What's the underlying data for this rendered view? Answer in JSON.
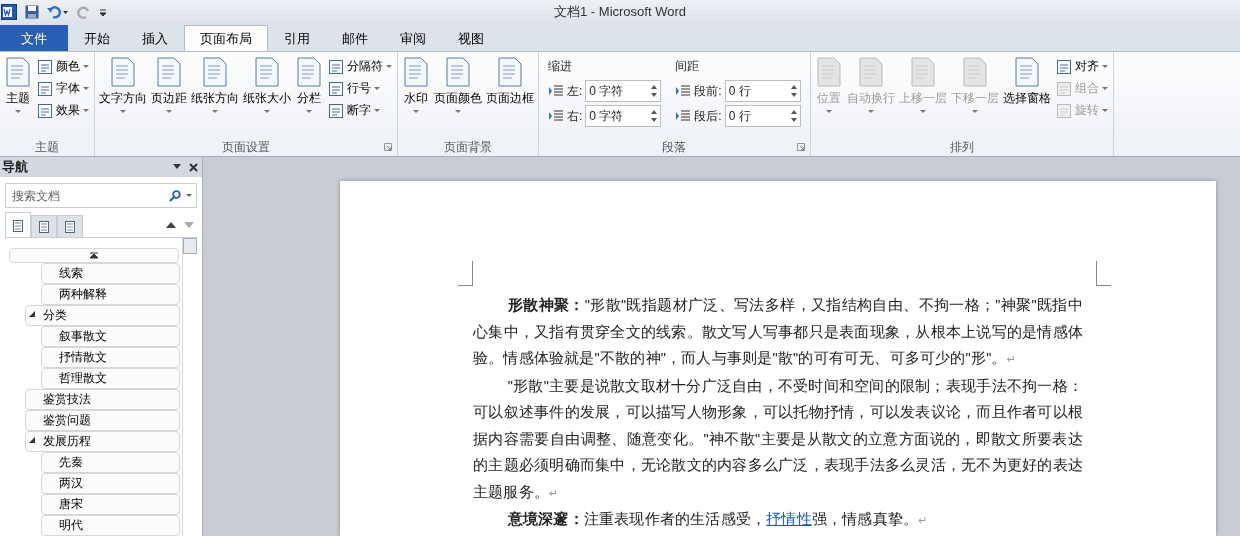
{
  "window": {
    "title": "文档1  -  Microsoft Word"
  },
  "tabs": [
    {
      "label": "文件",
      "kind": "file",
      "selected": false
    },
    {
      "label": "开始",
      "kind": "tab",
      "selected": false
    },
    {
      "label": "插入",
      "kind": "tab",
      "selected": false
    },
    {
      "label": "页面布局",
      "kind": "tab",
      "selected": true
    },
    {
      "label": "引用",
      "kind": "tab",
      "selected": false
    },
    {
      "label": "邮件",
      "kind": "tab",
      "selected": false
    },
    {
      "label": "审阅",
      "kind": "tab",
      "selected": false
    },
    {
      "label": "视图",
      "kind": "tab",
      "selected": false
    }
  ],
  "ribbon": {
    "groups": [
      {
        "kind": "buttons",
        "label": "主题",
        "launcher": false,
        "large": [
          {
            "label": "主题",
            "dropdown": true,
            "disabled": false
          }
        ],
        "small": [
          {
            "label": "颜色",
            "dropdown": true,
            "disabled": false
          },
          {
            "label": "字体",
            "dropdown": true,
            "disabled": false
          },
          {
            "label": "效果",
            "dropdown": true,
            "disabled": false
          }
        ]
      },
      {
        "kind": "buttons",
        "label": "页面设置",
        "launcher": true,
        "large": [
          {
            "label": "文字方向",
            "dropdown": true,
            "disabled": false
          },
          {
            "label": "页边距",
            "dropdown": true,
            "disabled": false
          },
          {
            "label": "纸张方向",
            "dropdown": true,
            "disabled": false
          },
          {
            "label": "纸张大小",
            "dropdown": true,
            "disabled": false
          },
          {
            "label": "分栏",
            "dropdown": true,
            "disabled": false
          }
        ],
        "small": [
          {
            "label": "分隔符",
            "dropdown": true,
            "disabled": false
          },
          {
            "label": "行号",
            "dropdown": true,
            "disabled": false
          },
          {
            "label": "断字",
            "dropdown": true,
            "disabled": false
          }
        ]
      },
      {
        "kind": "buttons",
        "label": "页面背景",
        "launcher": false,
        "large": [
          {
            "label": "水印",
            "dropdown": true,
            "disabled": false
          },
          {
            "label": "页面颜色",
            "dropdown": true,
            "disabled": false
          },
          {
            "label": "页面边框",
            "dropdown": false,
            "disabled": false
          }
        ]
      },
      {
        "kind": "paragraph",
        "label": "段落",
        "launcher": true,
        "columns": [
          {
            "heading": "缩进",
            "fields": [
              {
                "label": "左:",
                "value": "0 字符"
              },
              {
                "label": "右:",
                "value": "0 字符"
              }
            ]
          },
          {
            "heading": "间距",
            "fields": [
              {
                "label": "段前:",
                "value": "0 行"
              },
              {
                "label": "段后:",
                "value": "0 行"
              }
            ]
          }
        ]
      },
      {
        "kind": "buttons",
        "label": "排列",
        "launcher": false,
        "large": [
          {
            "label": "位置",
            "dropdown": true,
            "disabled": true
          },
          {
            "label": "自动换行",
            "dropdown": true,
            "disabled": true
          },
          {
            "label": "上移一层",
            "dropdown": true,
            "disabled": true
          },
          {
            "label": "下移一层",
            "dropdown": true,
            "disabled": true
          },
          {
            "label": "选择窗格",
            "dropdown": false,
            "disabled": false
          }
        ],
        "small": [
          {
            "label": "对齐",
            "dropdown": true,
            "disabled": false
          },
          {
            "label": "组合",
            "dropdown": true,
            "disabled": true
          },
          {
            "label": "旋转",
            "dropdown": true,
            "disabled": true
          }
        ]
      }
    ]
  },
  "navigation": {
    "title": "导航",
    "search": {
      "placeholder": "搜索文档"
    },
    "views": [
      {
        "selected": true
      },
      {
        "selected": false
      },
      {
        "selected": false
      }
    ],
    "outline": [
      {
        "children": [
          {
            "label": "线索"
          },
          {
            "label": "两种解释"
          }
        ]
      },
      {
        "label": "分类",
        "expanded": true,
        "children": [
          {
            "label": "叙事散文"
          },
          {
            "label": "抒情散文"
          },
          {
            "label": "哲理散文"
          }
        ]
      },
      {
        "label": "鉴赏技法"
      },
      {
        "label": "鉴赏问题"
      },
      {
        "label": "发展历程",
        "expanded": true,
        "children": [
          {
            "label": "先秦"
          },
          {
            "label": "两汉"
          },
          {
            "label": "唐宋"
          },
          {
            "label": "明代"
          }
        ]
      }
    ]
  },
  "document": {
    "paragraphs": [
      {
        "parts": [
          {
            "kind": "bold",
            "text": "形散神聚："
          },
          {
            "kind": "text",
            "text": "\"形散\"既指题材广泛、写法多样，又指结构自由、不拘一格；\"神聚\"既指中心集中，又指有贯穿全文的线索。散文写人写事都只是表面现象，从根本上说写的是情感体验。情感体验就是\"不散的神\"，而人与事则是\"散\"的可有可无、可多可少的\"形\"。"
          }
        ],
        "mark": "↵"
      },
      {
        "parts": [
          {
            "kind": "text",
            "text": "\"形散\"主要是说散文取材十分广泛自由，不受时间和空间的限制；表现手法不拘一格：可以叙述事件的发展，可以描写人物形象，可以托物抒情，可以发表议论，而且作者可以根据内容需要自由调整、随意变化。\"神不散\"主要是从散文的立意方面说的，即散文所要表达的主题必须明确而集中，无论散文的内容多么广泛，表现手法多么灵活，无不为更好的表达主题服务。"
          }
        ],
        "mark": "↵"
      },
      {
        "parts": [
          {
            "kind": "bold",
            "text": "意境深邃："
          },
          {
            "kind": "text",
            "text": "注重表现作者的生活感受，"
          },
          {
            "kind": "link",
            "text": "抒情性"
          },
          {
            "kind": "text",
            "text": "强，情感真挚。"
          }
        ],
        "mark": "↵"
      }
    ]
  }
}
